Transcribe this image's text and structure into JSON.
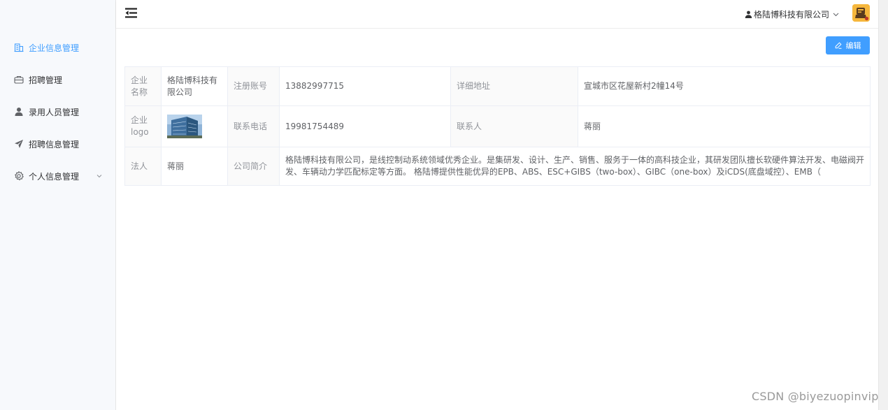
{
  "sidebar": {
    "items": [
      {
        "label": "企业信息管理",
        "icon": "building-icon",
        "active": true
      },
      {
        "label": "招聘管理",
        "icon": "briefcase-icon"
      },
      {
        "label": "录用人员管理",
        "icon": "user-icon"
      },
      {
        "label": "招聘信息管理",
        "icon": "send-icon"
      },
      {
        "label": "个人信息管理",
        "icon": "gear-icon",
        "expandable": true
      }
    ]
  },
  "header": {
    "user_name": "格陆博科技有限公司",
    "menu_icon": "hamburger-icon",
    "avatar_icon": "avatar"
  },
  "toolbar": {
    "edit_label": "编辑"
  },
  "company": {
    "name_label": "企业名称",
    "name_value": "格陆博科技有限公司",
    "account_label": "注册账号",
    "account_value": "13882997715",
    "address_label": "详细地址",
    "address_value": "宣城市区花屋新村2幢14号",
    "logo_label": "企业logo",
    "phone_label": "联系电话",
    "phone_value": "19981754489",
    "contact_label": "联系人",
    "contact_value": "蒋丽",
    "legal_label": "法人",
    "legal_value": "蒋丽",
    "intro_label": "公司简介",
    "intro_value": "格陆博科技有限公司，是线控制动系统领域优秀企业。是集研发、设计、生产、销售、服务于一体的高科技企业，其研发团队擅长软硬件算法开发、电磁阀开发、车辆动力学匹配标定等方面。 格陆博提供性能优异的EPB、ABS、ESC+GIBS（two-box）、GIBC（one-box）及iCDS(底盘域控）、EMB（"
  },
  "watermark": "CSDN @biyezuopinvip",
  "colors": {
    "accent": "#409eff",
    "sidebar_bg": "#f7f9fc",
    "label_bg": "#fafafa",
    "avatar_bg": "#f6b73c"
  }
}
